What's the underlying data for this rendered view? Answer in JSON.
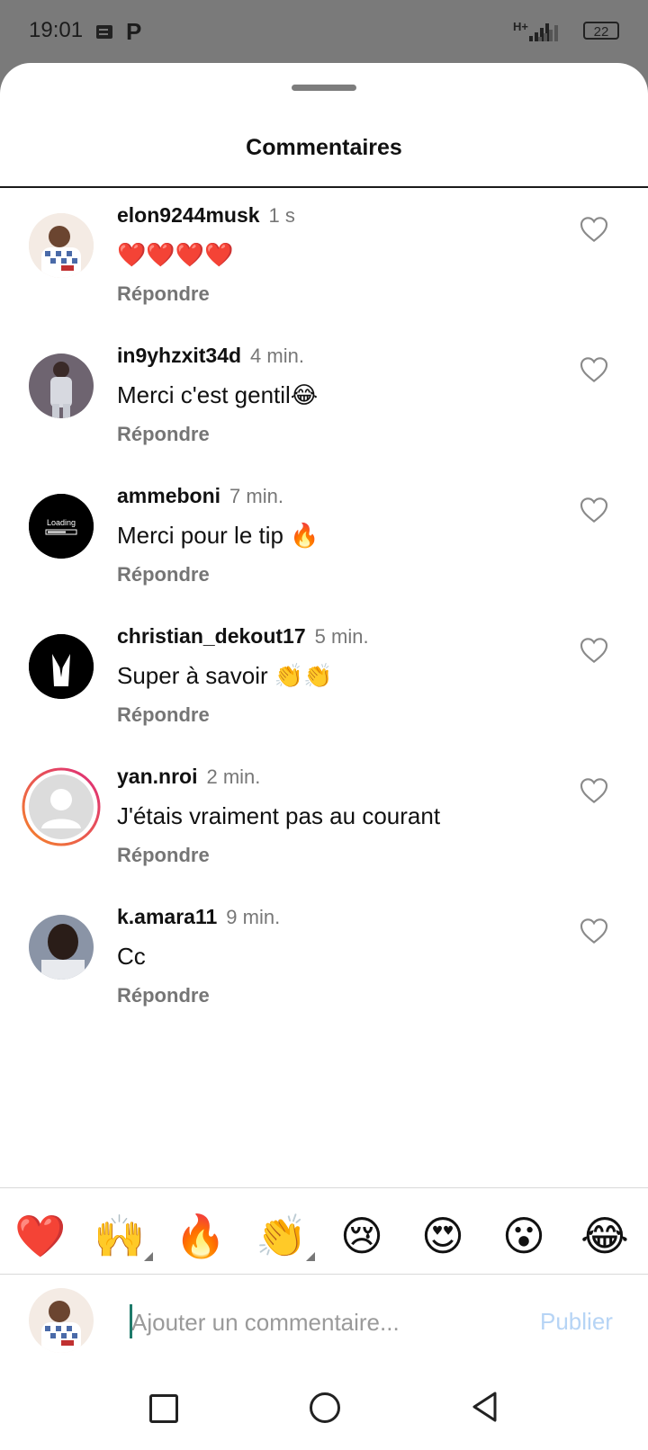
{
  "status_bar": {
    "time": "19:01",
    "network": "H+",
    "battery": "22",
    "icons": [
      "notes-icon",
      "p-icon",
      "signal-icon",
      "battery-icon"
    ]
  },
  "sheet": {
    "title": "Commentaires"
  },
  "comments": [
    {
      "user": "elon9244musk",
      "time": "1 s",
      "text": "❤️❤️❤️❤️",
      "reply": "Répondre"
    },
    {
      "user": "in9yhzxit34d",
      "time": "4 min.",
      "text": "Merci c'est gentil😂",
      "reply": "Répondre"
    },
    {
      "user": "ammeboni",
      "time": "7 min.",
      "text": "Merci pour le tip 🔥",
      "reply": "Répondre"
    },
    {
      "user": "christian_dekout17",
      "time": "5 min.",
      "text": "Super à savoir 👏👏",
      "reply": "Répondre"
    },
    {
      "user": "yan.nroi",
      "time": "2 min.",
      "text": "J'étais vraiment pas au courant",
      "reply": "Répondre"
    },
    {
      "user": "k.amara11",
      "time": "9 min.",
      "text": "Cc",
      "reply": "Répondre"
    }
  ],
  "avatar_texts": {
    "loading": "Loading"
  },
  "emoji_bar": [
    "❤️",
    "🙌",
    "🔥",
    "👏",
    "😢",
    "😍",
    "😮",
    "😂"
  ],
  "composer": {
    "placeholder": "Ajouter un commentaire...",
    "publish_label": "Publier"
  },
  "colors": {
    "status_bar_bg": "#7a7a7a",
    "publish_disabled": "#b6d4f5",
    "story_ring_start": "#f58529",
    "story_ring_end": "#dd2a7b",
    "meta_text": "#757575"
  }
}
